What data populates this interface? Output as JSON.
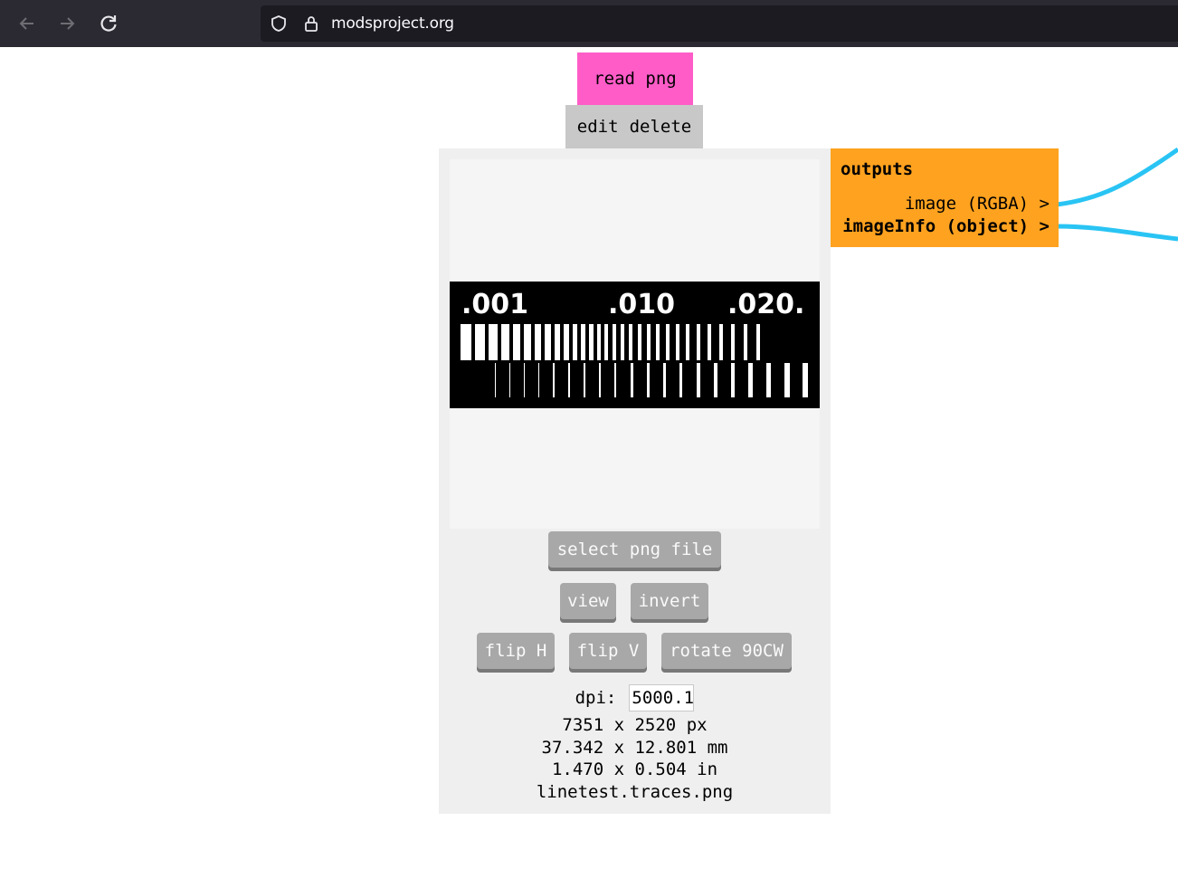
{
  "browser": {
    "url": "modsproject.org"
  },
  "module": {
    "title": "read png",
    "edit_label": "edit",
    "delete_label": "delete",
    "colors": {
      "title_bg": "#ff5cc8",
      "outputs_bg": "#ffa21f",
      "wire": "#29c4f4"
    },
    "preview_image": {
      "labels": [
        ".001",
        ".010",
        ".020."
      ]
    },
    "buttons": {
      "select_file": "select png file",
      "view": "view",
      "invert": "invert",
      "flip_h": "flip H",
      "flip_v": "flip V",
      "rotate": "rotate 90CW"
    },
    "dpi_label": "dpi:",
    "dpi_value": "5000.1",
    "size_px": "7351 x 2520 px",
    "size_mm": "37.342 x 12.801 mm",
    "size_in": "1.470 x 0.504 in",
    "filename": "linetest.traces.png"
  },
  "outputs": {
    "header": "outputs",
    "ports": [
      {
        "label": "image (RGBA) >"
      },
      {
        "label": "imageInfo (object) >"
      }
    ]
  }
}
